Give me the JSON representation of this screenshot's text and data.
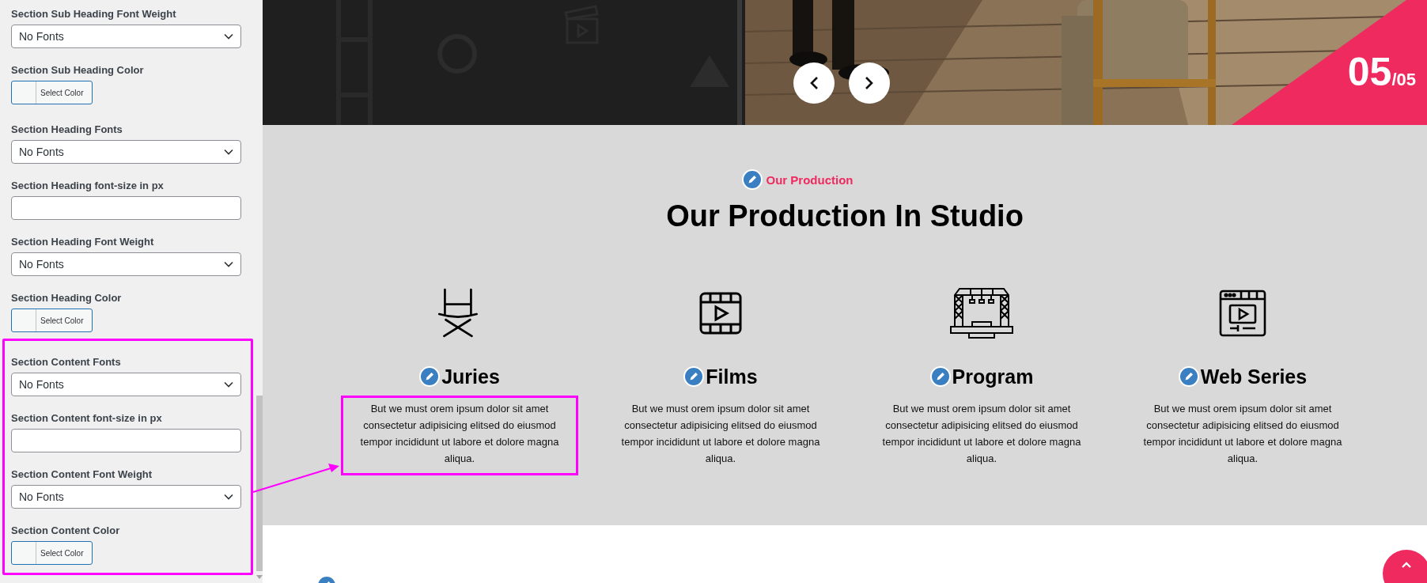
{
  "settings_panel": {
    "fields": [
      {
        "kind": "select",
        "label": "Section Sub Heading Font Weight",
        "value": "No Fonts"
      },
      {
        "kind": "color",
        "label": "Section Sub Heading Color",
        "button": "Select Color"
      },
      {
        "kind": "select",
        "label": "Section Heading Fonts",
        "value": "No Fonts"
      },
      {
        "kind": "input",
        "label": "Section Heading font-size in px"
      },
      {
        "kind": "select",
        "label": "Section Heading Font Weight",
        "value": "No Fonts"
      },
      {
        "kind": "color",
        "label": "Section Heading Color",
        "button": "Select Color"
      }
    ],
    "highlighted_fields": [
      {
        "kind": "select",
        "label": "Section Content Fonts",
        "value": "No Fonts"
      },
      {
        "kind": "input",
        "label": "Section Content font-size in px"
      },
      {
        "kind": "select",
        "label": "Section Content Font Weight",
        "value": "No Fonts"
      },
      {
        "kind": "color",
        "label": "Section Content Color",
        "button": "Select Color"
      }
    ]
  },
  "hero": {
    "slide_counter": {
      "current": "05",
      "total": "/05"
    }
  },
  "production_section": {
    "subtitle": "Our Production",
    "heading": "Our Production In Studio",
    "services": [
      {
        "kind": "chair",
        "title": "Juries",
        "text": "But we must orem ipsum dolor sit amet consectetur adipisicing elitsed do eiusmod tempor incididunt ut labore et dolore magna aliqua.",
        "highlighted": true
      },
      {
        "kind": "film",
        "title": "Films",
        "text": "But we must orem ipsum dolor sit amet consectetur adipisicing elitsed do eiusmod tempor incididunt ut labore et dolore magna aliqua.",
        "highlighted": false
      },
      {
        "kind": "stage",
        "title": "Program",
        "text": "But we must orem ipsum dolor sit amet consectetur adipisicing elitsed do eiusmod tempor incididunt ut labore et dolore magna aliqua.",
        "highlighted": false
      },
      {
        "kind": "web",
        "title": "Web Series",
        "text": "But we must orem ipsum dolor sit amet consectetur adipisicing elitsed do eiusmod tempor incididunt ut labore et dolore magna aliqua.",
        "highlighted": false
      }
    ]
  }
}
